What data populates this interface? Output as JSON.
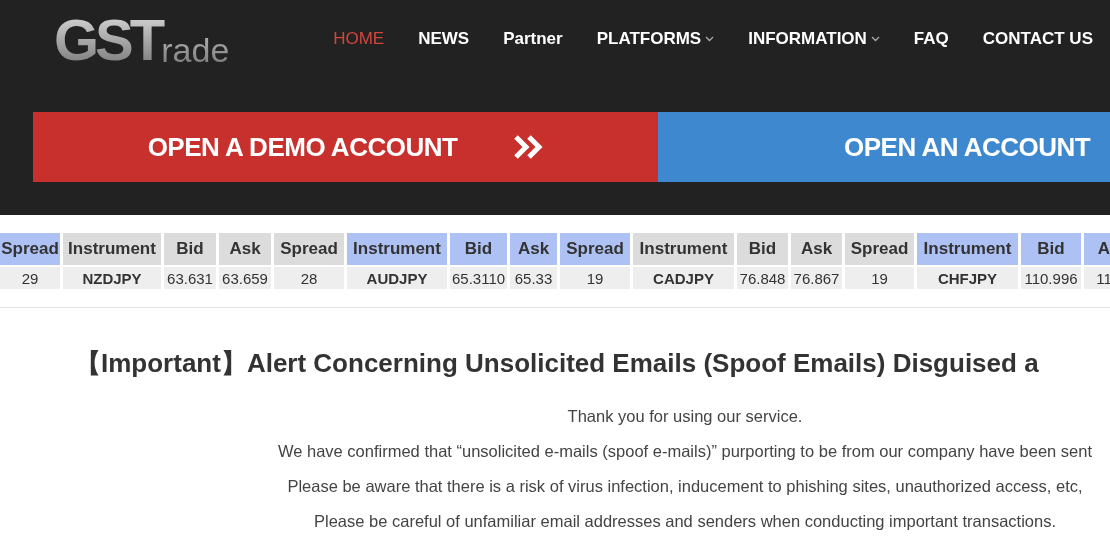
{
  "logo": {
    "main": "GST",
    "rest": "rade"
  },
  "nav": [
    {
      "label": "HOME",
      "selected": true,
      "dropdown": false
    },
    {
      "label": "NEWS",
      "selected": false,
      "dropdown": false
    },
    {
      "label": "Partner",
      "selected": false,
      "dropdown": false
    },
    {
      "label": "PLATFORMS",
      "selected": false,
      "dropdown": true
    },
    {
      "label": "INFORMATION",
      "selected": false,
      "dropdown": true
    },
    {
      "label": "FAQ",
      "selected": false,
      "dropdown": false
    },
    {
      "label": "CONTACT US",
      "selected": false,
      "dropdown": false
    }
  ],
  "banners": [
    {
      "label": "OPEN A DEMO ACCOUNT",
      "kind": "demo"
    },
    {
      "label": "OPEN AN ACCOUNT",
      "kind": "real"
    }
  ],
  "ticker": [
    {
      "header": "Spread",
      "value": "29",
      "highlighted": true,
      "kind": "num"
    },
    {
      "header": "Instrument",
      "value": "NZDJPY",
      "highlighted": false,
      "kind": "instrument"
    },
    {
      "header": "Bid",
      "value": "63.631",
      "highlighted": false,
      "kind": "num"
    },
    {
      "header": "Ask",
      "value": "63.659",
      "highlighted": false,
      "kind": "num"
    },
    {
      "header": "Spread",
      "value": "28",
      "highlighted": false,
      "kind": "num"
    },
    {
      "header": "Instrument",
      "value": "AUDJPY",
      "highlighted": true,
      "kind": "instrument"
    },
    {
      "header": "Bid",
      "value": "65.3110",
      "highlighted": true,
      "kind": "num"
    },
    {
      "header": "Ask",
      "value": "65.33",
      "highlighted": true,
      "kind": "num"
    },
    {
      "header": "Spread",
      "value": "19",
      "highlighted": true,
      "kind": "num"
    },
    {
      "header": "Instrument",
      "value": "CADJPY",
      "highlighted": false,
      "kind": "instrument"
    },
    {
      "header": "Bid",
      "value": "76.848",
      "highlighted": false,
      "kind": "num"
    },
    {
      "header": "Ask",
      "value": "76.867",
      "highlighted": false,
      "kind": "num"
    },
    {
      "header": "Spread",
      "value": "19",
      "highlighted": false,
      "kind": "num"
    },
    {
      "header": "Instrument",
      "value": "CHFJPY",
      "highlighted": true,
      "kind": "instrument"
    },
    {
      "header": "Bid",
      "value": "110.996",
      "highlighted": true,
      "kind": "num"
    },
    {
      "header": "A",
      "value": "11",
      "highlighted": true,
      "kind": "num"
    }
  ],
  "notice": {
    "title": "【Important】Alert Concerning Unsolicited Emails (Spoof Emails) Disguised a",
    "paragraphs": [
      "Thank you for using our service.",
      "We have confirmed that “unsolicited e-mails (spoof e-mails)” purporting to be from our company have been sent",
      "Please be aware that there is a risk of virus infection, inducement to phishing sites, unauthorized access, etc,",
      "Please be careful of unfamiliar email addresses and senders when conducting important transactions."
    ]
  }
}
